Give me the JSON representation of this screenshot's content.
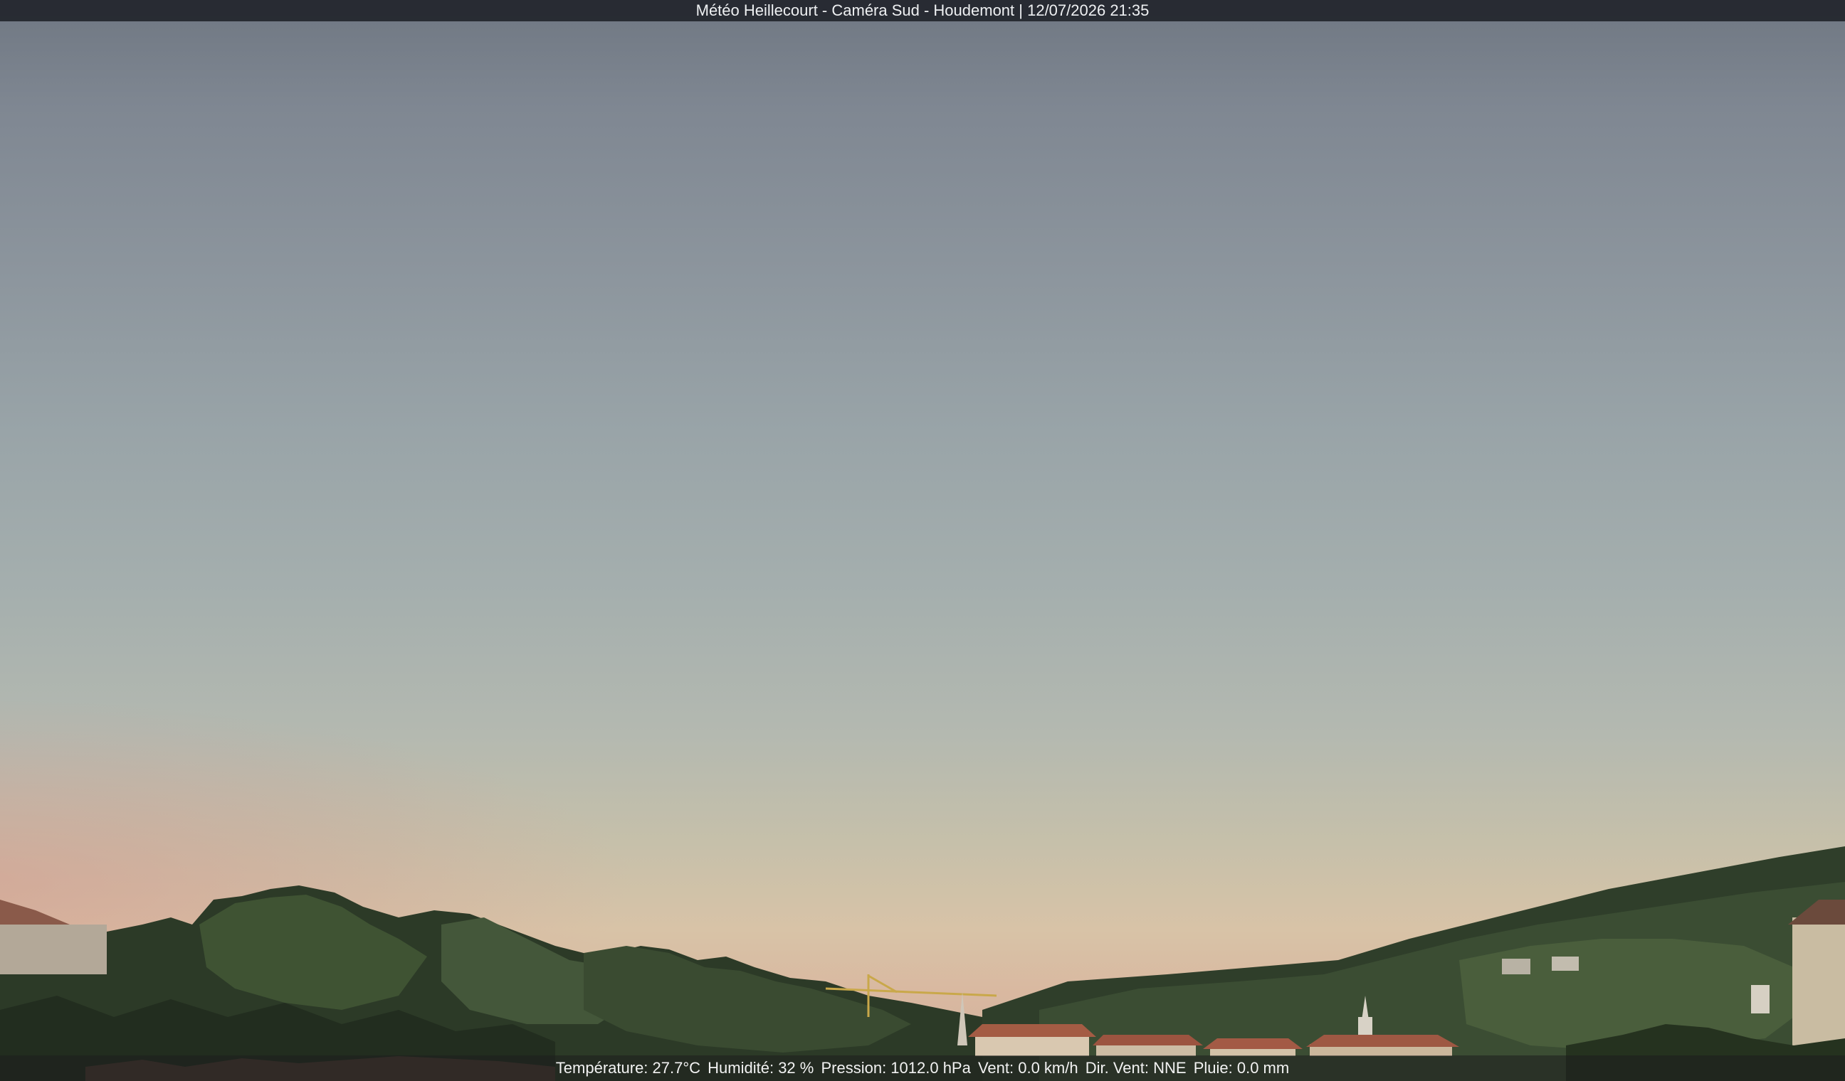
{
  "title_bar": {
    "text": "Météo Heillecourt - Caméra Sud - Houdemont | 12/07/2026 21:35"
  },
  "data_overlay": {
    "temperature": "Température: 27.7°C",
    "humidity": "Humidité: 32 %",
    "pressure": "Pression: 1012.0 hPa",
    "wind": "Vent: 0.0 km/h",
    "wind_direction": "Dir. Vent: NNE",
    "rain": "Pluie: 0.0 mm"
  },
  "colors": {
    "sky_top": "#6f7782",
    "sky_horizon": "#d8c3a7",
    "trees_dark": "#243222",
    "trees_mid": "#3a4c30",
    "trees_light": "#53663f",
    "roofs": "#9a5a48"
  }
}
